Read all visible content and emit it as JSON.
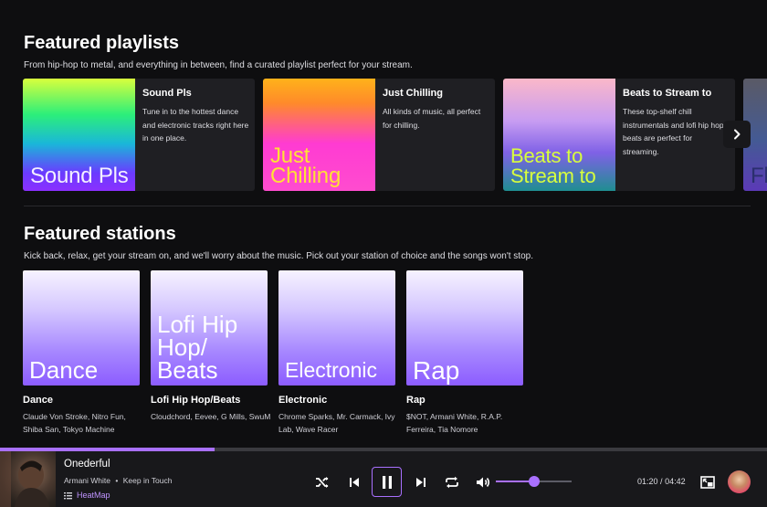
{
  "featured_playlists": {
    "title": "Featured playlists",
    "description": "From hip-hop to metal, and everything in between, find a curated playlist perfect for your stream.",
    "items": [
      {
        "art_text": "Sound Pls",
        "name": "Sound Pls",
        "description": "Tune in to the hottest dance and electronic tracks right here in one place."
      },
      {
        "art_text": "Just Chilling",
        "name": "Just Chilling",
        "description": "All kinds of music, all perfect for chilling."
      },
      {
        "art_text": "Beats to Stream to",
        "name": "Beats to Stream to",
        "description": "These top-shelf chill instrumentals and lofi hip hop beats are perfect for streaming."
      },
      {
        "art_text": "Fl",
        "name": "",
        "description": ""
      }
    ]
  },
  "featured_stations": {
    "title": "Featured stations",
    "description": "Kick back, relax, get your stream on, and we'll worry about the music. Pick out your station of choice and the songs won't stop.",
    "items": [
      {
        "art_text": "Dance",
        "name": "Dance",
        "artists": "Claude Von Stroke, Nitro Fun, Shiba San, Tokyo Machine"
      },
      {
        "art_text": "Lofi Hip Hop/ Beats",
        "name": "Lofi Hip Hop/Beats",
        "artists": "Cloudchord, Eevee, G Mills, SwuM"
      },
      {
        "art_text": "Electronic",
        "name": "Electronic",
        "artists": "Chrome Sparks, Mr. Carmack, Ivy Lab, Wave Racer"
      },
      {
        "art_text": "Rap",
        "name": "Rap",
        "artists": "$NOT, Armani White, R.A.P. Ferreira, Tia Nomore"
      }
    ]
  },
  "player": {
    "track_title": "Onederful",
    "artist": "Armani White",
    "separator": "•",
    "album": "Keep in Touch",
    "heatmap_label": "HeatMap",
    "elapsed": "01:20",
    "time_separator": "/",
    "duration": "04:42",
    "progress": 0.28,
    "volume": 0.5
  },
  "icons": {
    "next_carousel": "chevron-right-icon",
    "shuffle": "shuffle-icon",
    "previous": "skip-previous-icon",
    "play_pause": "pause-icon",
    "next": "skip-next-icon",
    "repeat": "repeat-icon",
    "volume": "volume-icon",
    "pip": "picture-in-picture-icon",
    "heatmap": "heatmap-icon"
  },
  "colors": {
    "accent": "#a970ff",
    "background": "#0e0e10",
    "card": "#1f1f23"
  }
}
